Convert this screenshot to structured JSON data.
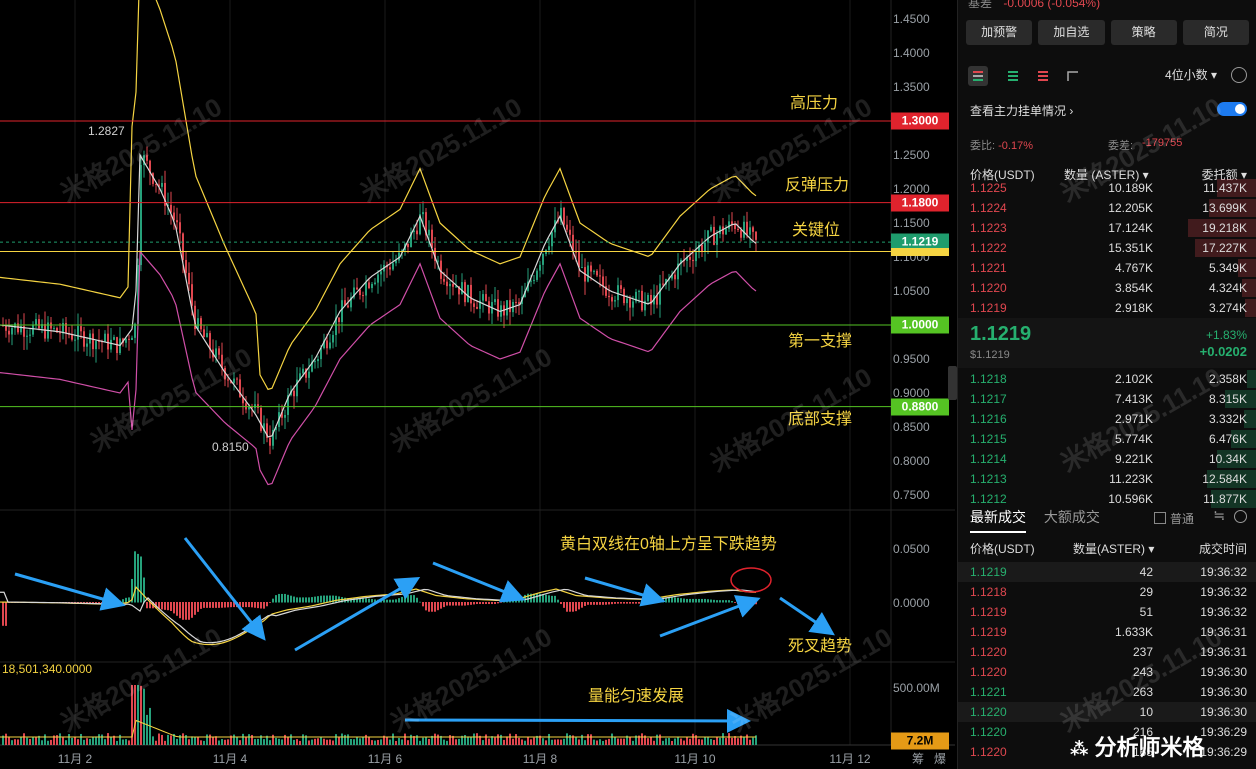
{
  "chart": {
    "y_labels": [
      "1.4500",
      "1.4000",
      "1.3500",
      "1.3000",
      "1.2500",
      "1.2000",
      "1.1500",
      "1.1000",
      "1.0500",
      "1.0000",
      "0.9500",
      "0.9000",
      "0.8500",
      "0.8000",
      "0.7500"
    ],
    "levels": [
      {
        "value": 1.3,
        "tag": "1.3000",
        "color": "#e0232d",
        "annotation": "高压力"
      },
      {
        "value": 1.18,
        "tag": "1.1800",
        "color": "#e0232d",
        "annotation": "反弹压力"
      },
      {
        "value": 1.1219,
        "tag": "1.1219",
        "color": "#1f9c6d",
        "annotation": "关键位"
      },
      {
        "value": 1.0,
        "tag": "1.0000",
        "color": "#55c423",
        "annotation": "第一支撑"
      },
      {
        "value": 0.88,
        "tag": "0.8800",
        "color": "#55c423",
        "annotation": "底部支撑"
      }
    ],
    "high_label": "1.2827",
    "low_label": "0.8150",
    "macd_labels": [
      "0.0500",
      "0.0000"
    ],
    "macd_annotation": "黄白双线在0轴上方呈下跌趋势",
    "macd_annotation2": "死叉趋势",
    "volume_value": "18,501,340.0000",
    "volume_axis": "500.00M",
    "volume_tag": "7.2M",
    "volume_annotation": "量能匀速发展",
    "x_labels": [
      "11月 2",
      "11月 4",
      "11月 6",
      "11月 8",
      "11月 10",
      "11月 12"
    ],
    "axis_extra": "筹",
    "axis_extra2": "爆",
    "watermark": "米格2025.11.10",
    "colors": {
      "up": "#26a17b",
      "down": "#e0474f",
      "yellow": "#f5d442",
      "white": "#d8d8d8",
      "pink": "#d04fa8",
      "arrow": "#2ba0f5"
    }
  },
  "panel": {
    "basis_label": "基差",
    "basis_value": "-0.0006 (-0.054%)",
    "buttons": [
      "加预警",
      "加自选",
      "策略",
      "简况"
    ],
    "decimals": "4位小数",
    "toggle_label": "查看主力挂单情况",
    "ratio_label": "委比:",
    "ratio_value": "-0.17%",
    "diff_label": "委差:",
    "diff_value": "-179755",
    "ob_headers": [
      "价格(USDT)",
      "数量 (ASTER)",
      "委托额"
    ],
    "asks": [
      {
        "p": "1.1225",
        "q": "10.189K",
        "t": "11.437K",
        "w": 0.5
      },
      {
        "p": "1.1224",
        "q": "12.205K",
        "t": "13.699K",
        "w": 0.6
      },
      {
        "p": "1.1223",
        "q": "17.124K",
        "t": "19.218K",
        "w": 0.86
      },
      {
        "p": "1.1222",
        "q": "15.351K",
        "t": "17.227K",
        "w": 0.77
      },
      {
        "p": "1.1221",
        "q": "4.767K",
        "t": "5.349K",
        "w": 0.24
      },
      {
        "p": "1.1220",
        "q": "3.854K",
        "t": "4.324K",
        "w": 0.19
      },
      {
        "p": "1.1219",
        "q": "2.918K",
        "t": "3.274K",
        "w": 0.15
      }
    ],
    "last_price": "1.1219",
    "last_price_usd": "$1.1219",
    "change_pct": "+1.83%",
    "change_abs": "+0.0202",
    "bids": [
      {
        "p": "1.1218",
        "q": "2.102K",
        "t": "2.358K",
        "w": 0.12
      },
      {
        "p": "1.1217",
        "q": "7.413K",
        "t": "8.315K",
        "w": 0.4
      },
      {
        "p": "1.1216",
        "q": "2.971K",
        "t": "3.332K",
        "w": 0.16
      },
      {
        "p": "1.1215",
        "q": "5.774K",
        "t": "6.476K",
        "w": 0.32
      },
      {
        "p": "1.1214",
        "q": "9.221K",
        "t": "10.34K",
        "w": 0.5
      },
      {
        "p": "1.1213",
        "q": "11.223K",
        "t": "12.584K",
        "w": 0.62
      },
      {
        "p": "1.1212",
        "q": "10.596K",
        "t": "11.877K",
        "w": 0.58
      }
    ],
    "tab_latest": "最新成交",
    "tab_large": "大额成交",
    "checkbox_label": "普通",
    "trade_headers": [
      "价格(USDT)",
      "数量(ASTER)",
      "成交时间"
    ],
    "trades": [
      {
        "p": "1.1219",
        "q": "42",
        "t": "19:36:32",
        "side": "buy"
      },
      {
        "p": "1.1218",
        "q": "29",
        "t": "19:36:32",
        "side": "sell"
      },
      {
        "p": "1.1219",
        "q": "51",
        "t": "19:36:32",
        "side": "sell"
      },
      {
        "p": "1.1219",
        "q": "1.633K",
        "t": "19:36:31",
        "side": "sell"
      },
      {
        "p": "1.1220",
        "q": "237",
        "t": "19:36:31",
        "side": "sell"
      },
      {
        "p": "1.1220",
        "q": "243",
        "t": "19:36:30",
        "side": "sell"
      },
      {
        "p": "1.1221",
        "q": "263",
        "t": "19:36:30",
        "side": "buy"
      },
      {
        "p": "1.1220",
        "q": "10",
        "t": "19:36:30",
        "side": "buy"
      },
      {
        "p": "1.1220",
        "q": "216",
        "t": "19:36:29",
        "side": "buy"
      },
      {
        "p": "1.1220",
        "q": "165",
        "t": "19:36:29",
        "side": "sell"
      }
    ],
    "brand": "分析师米格"
  }
}
